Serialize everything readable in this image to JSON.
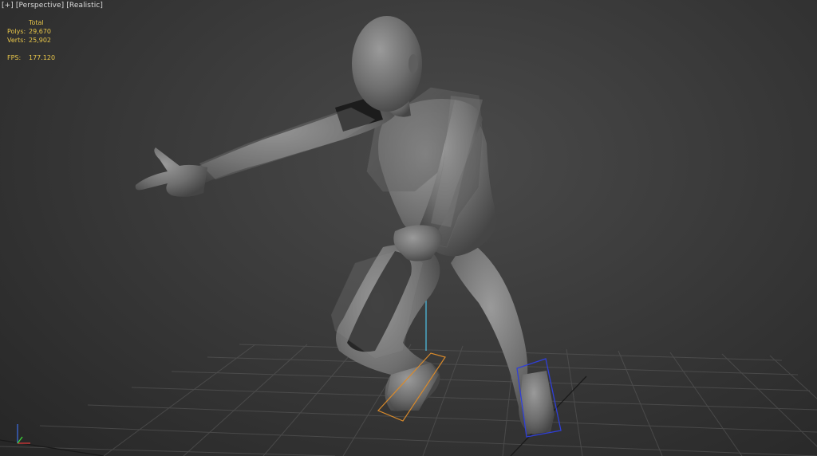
{
  "viewport": {
    "labels": [
      "[+]",
      "[Perspective]",
      "[Realistic]"
    ]
  },
  "statistics": {
    "header": "Total",
    "polys_label": "Polys:",
    "polys_value": "29,670",
    "verts_label": "Verts:",
    "verts_value": "25,902",
    "fps_label": "FPS:",
    "fps_value": "177.120"
  },
  "colors": {
    "background": "#3a3a3a",
    "stats_text": "#e8c64a",
    "grid_line": "#6a6a6a",
    "selection_orange": "#d98a2b",
    "selection_blue": "#2f3fd8",
    "pivot_cyan": "#4fc3e8",
    "axis_x": "#d83a3a",
    "axis_y": "#3ad83a",
    "axis_z": "#3a6ad8"
  },
  "scene": {
    "object": "character-mesh",
    "gizmo": "view-axis-tripod"
  }
}
